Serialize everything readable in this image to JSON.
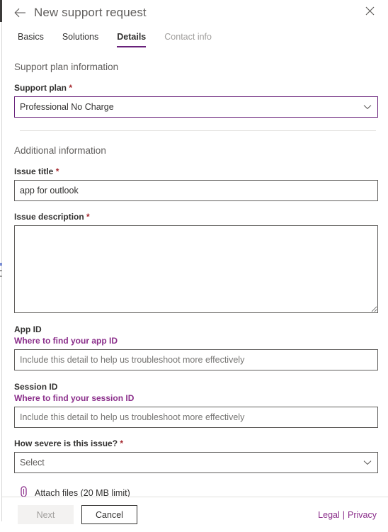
{
  "header": {
    "title": "New support request",
    "back_icon": "arrow-left-icon",
    "close_icon": "close-icon"
  },
  "tabs": [
    {
      "label": "Basics",
      "state": "normal"
    },
    {
      "label": "Solutions",
      "state": "normal"
    },
    {
      "label": "Details",
      "state": "selected"
    },
    {
      "label": "Contact info",
      "state": "disabled"
    }
  ],
  "sections": {
    "support_plan_heading": "Support plan information",
    "additional_heading": "Additional information"
  },
  "fields": {
    "support_plan": {
      "label": "Support plan",
      "required": true,
      "value": "Professional No Charge",
      "chevron_icon": "chevron-down-icon"
    },
    "issue_title": {
      "label": "Issue title",
      "required": true,
      "value": "app for outlook",
      "placeholder": ""
    },
    "issue_description": {
      "label": "Issue description",
      "required": true,
      "value": "",
      "placeholder": ""
    },
    "app_id": {
      "label": "App ID",
      "required": false,
      "link": "Where to find your app ID",
      "value": "",
      "placeholder": "Include this detail to help us troubleshoot more effectively"
    },
    "session_id": {
      "label": "Session ID",
      "required": false,
      "link": "Where to find your session ID",
      "value": "",
      "placeholder": "Include this detail to help us troubleshoot more effectively"
    },
    "severity": {
      "label": "How severe is this issue?",
      "required": true,
      "value": "Select",
      "chevron_icon": "chevron-down-icon"
    }
  },
  "attach": {
    "icon": "paperclip-icon",
    "label": "Attach files (20 MB limit)"
  },
  "footer": {
    "next_label": "Next",
    "cancel_label": "Cancel",
    "legal_label": "Legal",
    "separator": "|",
    "privacy_label": "Privacy"
  },
  "colors": {
    "accent_purple": "#68217a",
    "link_purple": "#8b2f8b",
    "required_red": "#a4262c",
    "border_gray": "#605e5c",
    "divider": "#e1dfdd"
  }
}
